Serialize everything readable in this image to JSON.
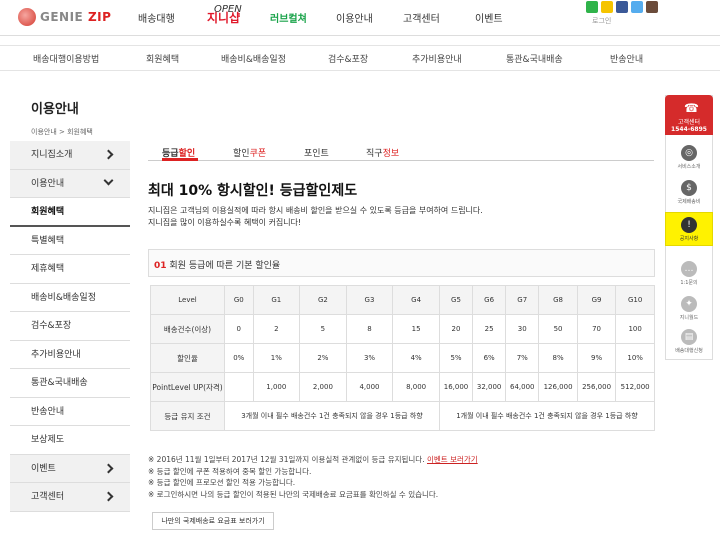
{
  "header": {
    "logo_text": "GENIE",
    "logo_accent": "ZIP",
    "nav": [
      "배송대행",
      "지니샵",
      "러브컬쳐",
      "이용안내",
      "고객센터",
      "이벤트"
    ],
    "new_badge": "OPEN",
    "login_label": "로그인"
  },
  "subnav": [
    "배송대행이용방법",
    "회원혜택",
    "배송비&배송일정",
    "검수&포장",
    "추가비용안내",
    "통관&국내배송",
    "반송안내"
  ],
  "sidebar": {
    "title": "이용안내",
    "breadcrumb": "이용안내  >  회원혜택",
    "items": [
      {
        "label": "지니집소개",
        "chevron": "right"
      },
      {
        "label": "이용안내",
        "chevron": "down"
      },
      {
        "label": "회원혜택",
        "active": true
      },
      {
        "label": "특별혜택"
      },
      {
        "label": "제휴혜택"
      },
      {
        "label": "배송비&배송일정"
      },
      {
        "label": "검수&포장"
      },
      {
        "label": "추가비용안내"
      },
      {
        "label": "통관&국내배송"
      },
      {
        "label": "반송안내"
      },
      {
        "label": "보상제도"
      },
      {
        "label": "이벤트",
        "chevron": "right"
      },
      {
        "label": "고객센터",
        "chevron": "right"
      }
    ]
  },
  "tabs": [
    {
      "prefix": "등급",
      "accent": "할인"
    },
    {
      "prefix": "할인",
      "accent": "쿠폰"
    },
    {
      "prefix": "포인트",
      "accent": ""
    },
    {
      "prefix": "직구",
      "accent": "정보"
    }
  ],
  "content": {
    "headline": "최대 10% 항시할인! 등급할인제도",
    "desc1": "지니집은 고객님의 이용실적에 따라 항시 배송비 할인을 받으실 수 있도록 등급을 부여하여 드립니다.",
    "desc2": "지니집을 많이 이용하실수록 혜택이 커집니다!",
    "section_num": "01",
    "section_title": "회원 등급에 따른 기본 할인율"
  },
  "table": {
    "header_label": "Level",
    "levels": [
      "G0",
      "G1",
      "G2",
      "G3",
      "G4",
      "G5",
      "G6",
      "G7",
      "G8",
      "G9",
      "G10"
    ],
    "row_count_label": "배송건수(이상)",
    "counts": [
      "0",
      "2",
      "5",
      "8",
      "15",
      "20",
      "25",
      "30",
      "50",
      "70",
      "100"
    ],
    "row_rate_label": "할인율",
    "rates": [
      "0%",
      "1%",
      "2%",
      "3%",
      "4%",
      "5%",
      "6%",
      "7%",
      "8%",
      "9%",
      "10%"
    ],
    "row_point_label": "PointLevel UP(자격)",
    "points": [
      "",
      "1,000",
      "2,000",
      "4,000",
      "8,000",
      "16,000",
      "32,000",
      "64,000",
      "126,000",
      "256,000",
      "512,000"
    ],
    "row_keep_label": "등급 유지 조건",
    "keep_left": "3개월 이내 필수 배송건수 1건 충족되지 않을 경우 1등급 하향",
    "keep_right": "1개월 이내 필수 배송건수 1건 충족되지 않을 경우 1등급 하향"
  },
  "notes": {
    "n1": "※ 2016년 11월 1일부터 2017년 12월 31일까지 이용실적 관계없이 등급 유지됩니다.",
    "n1_link": "이벤트 보러가기",
    "n2": "※ 등급 할인에 쿠폰 적용하여 중복 할인 가능합니다.",
    "n3": "※ 등급 할인에 프로모션 할인 적용 가능합니다.",
    "n4": "※ 로그인하시면 나의 등급 할인이 적용된 나만의 국제배송료 요금표를 확인하실 수 있습니다.",
    "button": "나만의 국제배송료 요금표 보러가기"
  },
  "quick": {
    "call_title": "고객센터",
    "call_number": "1544-6895",
    "items": [
      "서비스소개",
      "국제배송비",
      "공지사항",
      "1:1문의",
      "지니월드",
      "배송대행신청"
    ]
  },
  "colors": {
    "accent": "#d22222",
    "green": "#1aa34a",
    "notice_yellow": "#fff200"
  }
}
